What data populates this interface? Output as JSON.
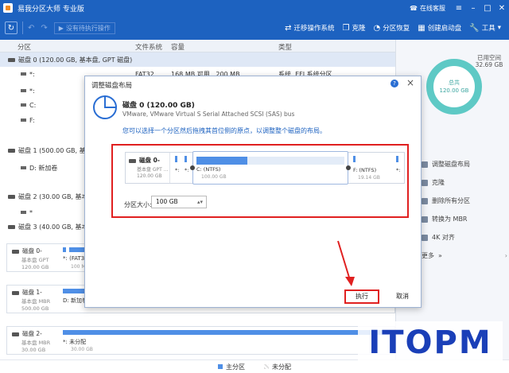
{
  "app": {
    "title": "易我分区大师 专业版",
    "user_label": "在线客服"
  },
  "toolbar": {
    "pending_label": "没有待执行操作",
    "items": [
      {
        "label": "迁移操作系统",
        "icon": "migrate-os-icon"
      },
      {
        "label": "克隆",
        "icon": "clone-icon"
      },
      {
        "label": "分区恢复",
        "icon": "partition-recovery-icon"
      },
      {
        "label": "创建启动盘",
        "icon": "bootable-media-icon"
      },
      {
        "label": "工具",
        "icon": "tools-icon"
      }
    ]
  },
  "table": {
    "headers": {
      "partition": "分区",
      "filesystem": "文件系统",
      "capacity": "容量",
      "type": "类型"
    },
    "rows": [
      {
        "name": "磁盘 0 (120.00 GB, 基本盘, GPT 磁盘)",
        "kind": "disk",
        "selected": true
      },
      {
        "name": "*:",
        "fs": "FAT32",
        "cap": "168 MB   可用    ,  200 MB",
        "type": "系统, EFI 系统分区",
        "kind": "part"
      },
      {
        "name": "*:",
        "kind": "part"
      },
      {
        "name": "C:",
        "kind": "part"
      },
      {
        "name": "F:",
        "kind": "part"
      },
      {
        "name": "磁盘 1 (500.00 GB, 基本盘",
        "kind": "disk"
      },
      {
        "name": "D: 新加卷",
        "kind": "part"
      },
      {
        "name": "磁盘 2 (30.00 GB, 基本盘",
        "kind": "disk"
      },
      {
        "name": "*",
        "kind": "part"
      },
      {
        "name": "磁盘 3 (40.00 GB, 基本盘",
        "kind": "disk"
      }
    ]
  },
  "disk_maps": [
    {
      "name": "磁盘 0-",
      "sub1": "基本盘 GPT",
      "sub2": "120.00 GB",
      "part_label": "*: (FAT32",
      "part_sub": "100 MB"
    },
    {
      "name": "磁盘 1-",
      "sub1": "基本盘 MBR",
      "sub2": "500.00 GB",
      "part_label": "D: 新加卷",
      "part_sub": ""
    },
    {
      "name": "磁盘 2-",
      "sub1": "基本盘 MBR",
      "sub2": "30.00 GB",
      "part_label": "*: 未分配",
      "part_sub": "30.00 GB"
    }
  ],
  "right_panel": {
    "used_label": "已用空间",
    "used_value": "32.69 GB",
    "total_label": "总共",
    "total_value": "120.00 GB",
    "donut_color": "#5ec9c5",
    "actions": [
      "调整磁盘布局",
      "克隆",
      "删除所有分区",
      "转换为 MBR",
      "4K 对齐",
      "更多"
    ]
  },
  "legend": {
    "primary": "主分区",
    "unallocated": "未分配",
    "primary_color": "#4f8fe6"
  },
  "modal": {
    "title": "调整磁盘布局",
    "disk_title": "磁盘 0 (120.00 GB)",
    "disk_desc": "VMware,  VMware Virtual S Serial Attached SCSI (SAS) bus",
    "hint": "您可以选择一个分区然后拖拽其首位侧的原点，以调整整个磁盘的布局。",
    "layout": {
      "disk_name": "磁盘 0-",
      "disk_sub1": "基本盘 GPT ...",
      "disk_sub2": "120.00 GB",
      "partitions": [
        {
          "label": "*:",
          "sub": ""
        },
        {
          "label": "*:",
          "sub": ""
        },
        {
          "label": "C: (NTFS)",
          "sub": "100.00 GB"
        },
        {
          "label": "F: (NTFS)",
          "sub": "19.14 GB"
        },
        {
          "label": "*:",
          "sub": ""
        }
      ]
    },
    "size_label": "分区大小:",
    "size_value": "100 GB",
    "execute_label": "执行",
    "cancel_label": "取消"
  },
  "watermark": "ITOPM"
}
